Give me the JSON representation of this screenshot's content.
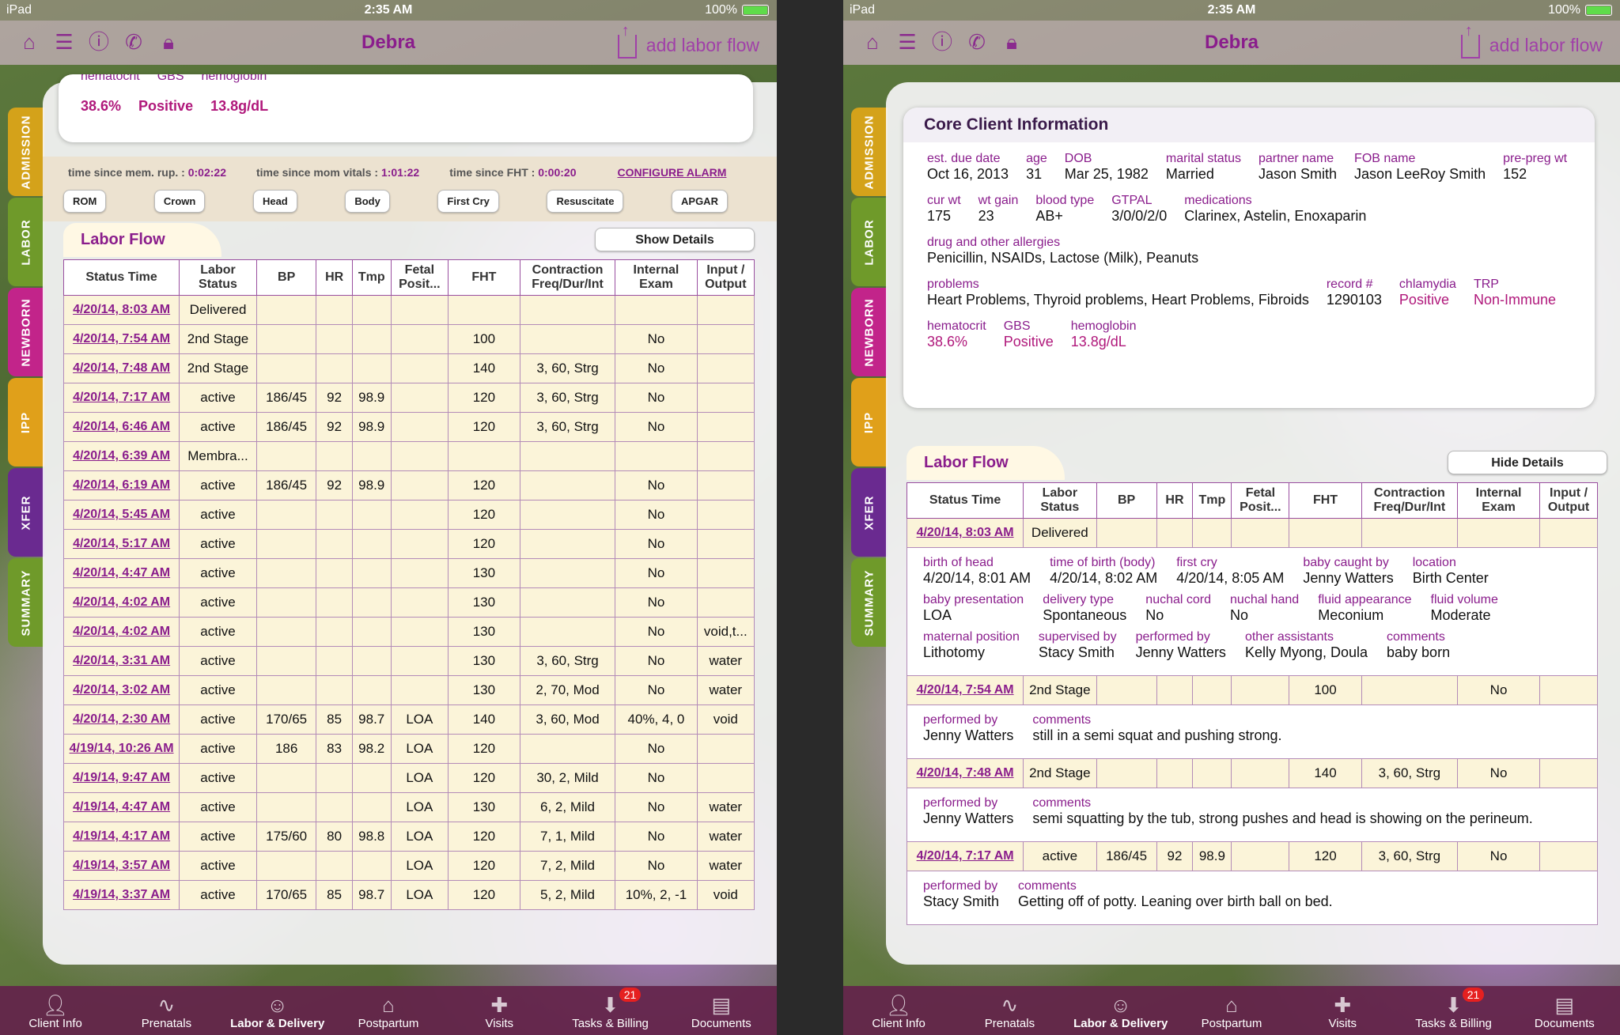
{
  "status_bar": {
    "device": "iPad",
    "time": "2:35 AM",
    "battery": "100%"
  },
  "nav": {
    "title": "Debra",
    "add_flow": "add labor flow"
  },
  "side_tabs": [
    {
      "label": "ADMISSION",
      "color": "#d4a21a"
    },
    {
      "label": "LABOR",
      "color": "#6f9a2a"
    },
    {
      "label": "NEWBORN",
      "color": "#c2248a"
    },
    {
      "label": "IPP",
      "color": "#e0a01a"
    },
    {
      "label": "XFER",
      "color": "#6a2a90"
    },
    {
      "label": "SUMMARY",
      "color": "#6f9a2a"
    }
  ],
  "left": {
    "top_card": {
      "partial_labels": [
        "hematocrit",
        "GBS",
        "hemoglobin"
      ],
      "values": [
        "38.6%",
        "Positive",
        "13.8g/dL"
      ]
    },
    "timers": [
      {
        "label": "time since mem. rup. :",
        "value": "0:02:22"
      },
      {
        "label": "time since mom vitals :",
        "value": "1:01:22"
      },
      {
        "label": "time since FHT :",
        "value": "0:00:20"
      }
    ],
    "configure_alarm": "CONFIGURE ALARM",
    "event_buttons": [
      "ROM",
      "Crown",
      "Head",
      "Body",
      "First Cry",
      "Resuscitate",
      "APGAR"
    ],
    "section_title": "Labor Flow",
    "details_button": "Show Details"
  },
  "table_headers": [
    "Status Time",
    "Labor Status",
    "BP",
    "HR",
    "Tmp",
    "Fetal Posit...",
    "FHT",
    "Contraction Freq/Dur/Int",
    "Internal Exam",
    "Input / Output"
  ],
  "rows": [
    [
      "4/20/14, 8:03 AM",
      "Delivered",
      "",
      "",
      "",
      "",
      "",
      "",
      "",
      ""
    ],
    [
      "4/20/14, 7:54 AM",
      "2nd Stage",
      "",
      "",
      "",
      "",
      "100",
      "",
      "No",
      ""
    ],
    [
      "4/20/14, 7:48 AM",
      "2nd Stage",
      "",
      "",
      "",
      "",
      "140",
      "3, 60, Strg",
      "No",
      ""
    ],
    [
      "4/20/14, 7:17 AM",
      "active",
      "186/45",
      "92",
      "98.9",
      "",
      "120",
      "3, 60, Strg",
      "No",
      ""
    ],
    [
      "4/20/14, 6:46 AM",
      "active",
      "186/45",
      "92",
      "98.9",
      "",
      "120",
      "3, 60, Strg",
      "No",
      ""
    ],
    [
      "4/20/14, 6:39 AM",
      "Membra...",
      "",
      "",
      "",
      "",
      "",
      "",
      "",
      ""
    ],
    [
      "4/20/14, 6:19 AM",
      "active",
      "186/45",
      "92",
      "98.9",
      "",
      "120",
      "",
      "No",
      ""
    ],
    [
      "4/20/14, 5:45 AM",
      "active",
      "",
      "",
      "",
      "",
      "120",
      "",
      "No",
      ""
    ],
    [
      "4/20/14, 5:17 AM",
      "active",
      "",
      "",
      "",
      "",
      "120",
      "",
      "No",
      ""
    ],
    [
      "4/20/14, 4:47 AM",
      "active",
      "",
      "",
      "",
      "",
      "130",
      "",
      "No",
      ""
    ],
    [
      "4/20/14, 4:02 AM",
      "active",
      "",
      "",
      "",
      "",
      "130",
      "",
      "No",
      ""
    ],
    [
      "4/20/14, 4:02 AM",
      "active",
      "",
      "",
      "",
      "",
      "130",
      "",
      "No",
      "void,t..."
    ],
    [
      "4/20/14, 3:31 AM",
      "active",
      "",
      "",
      "",
      "",
      "130",
      "3, 60, Strg",
      "No",
      "water"
    ],
    [
      "4/20/14, 3:02 AM",
      "active",
      "",
      "",
      "",
      "",
      "130",
      "2, 70, Mod",
      "No",
      "water"
    ],
    [
      "4/20/14, 2:30 AM",
      "active",
      "170/65",
      "85",
      "98.7",
      "LOA",
      "140",
      "3, 60, Mod",
      "40%, 4, 0",
      "void"
    ],
    [
      "4/19/14, 10:26 AM",
      "active",
      "186",
      "83",
      "98.2",
      "LOA",
      "120",
      "",
      "No",
      ""
    ],
    [
      "4/19/14, 9:47 AM",
      "active",
      "",
      "",
      "",
      "LOA",
      "120",
      "30, 2, Mild",
      "No",
      ""
    ],
    [
      "4/19/14, 4:47 AM",
      "active",
      "",
      "",
      "",
      "LOA",
      "130",
      "6, 2, Mild",
      "No",
      "water"
    ],
    [
      "4/19/14, 4:17 AM",
      "active",
      "175/60",
      "80",
      "98.8",
      "LOA",
      "120",
      "7, 1, Mild",
      "No",
      "water"
    ],
    [
      "4/19/14, 3:57 AM",
      "active",
      "",
      "",
      "",
      "LOA",
      "120",
      "7, 2, Mild",
      "No",
      "water"
    ],
    [
      "4/19/14, 3:37 AM",
      "active",
      "170/65",
      "85",
      "98.7",
      "LOA",
      "120",
      "5, 2, Mild",
      "10%, 2, -1",
      "void"
    ]
  ],
  "right": {
    "core_title": "Core Client Information",
    "core_rows": [
      [
        {
          "label": "est. due date",
          "value": "Oct 16, 2013"
        },
        {
          "label": "age",
          "value": "31"
        },
        {
          "label": "DOB",
          "value": "Mar 25, 1982"
        },
        {
          "label": "marital status",
          "value": "Married"
        },
        {
          "label": "partner name",
          "value": "Jason Smith"
        },
        {
          "label": "FOB name",
          "value": "Jason LeeRoy Smith"
        },
        {
          "label": "pre-preg wt",
          "value": "152"
        }
      ],
      [
        {
          "label": "cur wt",
          "value": "175"
        },
        {
          "label": "wt gain",
          "value": "23"
        },
        {
          "label": "blood type",
          "value": "AB+"
        },
        {
          "label": "GTPAL",
          "value": "3/0/0/2/0"
        },
        {
          "label": "medications",
          "value": "Clarinex, Astelin, Enoxaparin"
        }
      ],
      [
        {
          "label": "drug and other allergies",
          "value": "Penicillin, NSAIDs, Lactose (Milk), Peanuts"
        }
      ],
      [
        {
          "label": "problems",
          "value": "Heart Problems, Thyroid problems, Heart Problems, Fibroids"
        },
        {
          "label": "record #",
          "value": "1290103"
        },
        {
          "label": "chlamydia",
          "value": "Positive",
          "pink": true
        },
        {
          "label": "TRP",
          "value": "Non-Immune",
          "pink": true
        }
      ],
      [
        {
          "label": "hematocrit",
          "value": "38.6%",
          "pink": true
        },
        {
          "label": "GBS",
          "value": "Positive",
          "pink": true
        },
        {
          "label": "hemoglobin",
          "value": "13.8g/dL",
          "pink": true
        }
      ]
    ],
    "section_title": "Labor Flow",
    "details_button": "Hide Details",
    "flow": [
      {
        "row": [
          "4/20/14, 8:03 AM",
          "Delivered",
          "",
          "",
          "",
          "",
          "",
          "",
          "",
          ""
        ],
        "details": [
          [
            {
              "label": "birth of head",
              "value": "4/20/14, 8:01 AM"
            },
            {
              "label": "time of birth (body)",
              "value": "4/20/14, 8:02 AM"
            },
            {
              "label": "first cry",
              "value": "4/20/14, 8:05 AM"
            },
            {
              "label": "baby caught by",
              "value": "Jenny Watters"
            },
            {
              "label": "location",
              "value": "Birth Center"
            }
          ],
          [
            {
              "label": "baby presentation",
              "value": "LOA"
            },
            {
              "label": "delivery type",
              "value": "Spontaneous"
            },
            {
              "label": "nuchal cord",
              "value": "No"
            },
            {
              "label": "nuchal hand",
              "value": "No"
            },
            {
              "label": "fluid appearance",
              "value": "Meconium"
            },
            {
              "label": "fluid volume",
              "value": "Moderate"
            }
          ],
          [
            {
              "label": "maternal position",
              "value": "Lithotomy"
            },
            {
              "label": "supervised by",
              "value": "Stacy Smith"
            },
            {
              "label": "performed by",
              "value": "Jenny Watters"
            },
            {
              "label": "other assistants",
              "value": "Kelly Myong, Doula"
            },
            {
              "label": "comments",
              "value": "baby born"
            }
          ]
        ]
      },
      {
        "row": [
          "4/20/14, 7:54 AM",
          "2nd Stage",
          "",
          "",
          "",
          "",
          "100",
          "",
          "No",
          ""
        ],
        "details": [
          [
            {
              "label": "performed by",
              "value": "Jenny Watters"
            },
            {
              "label": "comments",
              "value": "still in a semi squat and pushing strong."
            }
          ]
        ]
      },
      {
        "row": [
          "4/20/14, 7:48 AM",
          "2nd Stage",
          "",
          "",
          "",
          "",
          "140",
          "3, 60, Strg",
          "No",
          ""
        ],
        "details": [
          [
            {
              "label": "performed by",
              "value": "Jenny Watters"
            },
            {
              "label": "comments",
              "value": "semi squatting by the tub, strong pushes and head is showing on the perineum."
            }
          ]
        ]
      },
      {
        "row": [
          "4/20/14, 7:17 AM",
          "active",
          "186/45",
          "92",
          "98.9",
          "",
          "120",
          "3, 60, Strg",
          "No",
          ""
        ],
        "details": [
          [
            {
              "label": "performed by",
              "value": "Stacy Smith"
            },
            {
              "label": "comments",
              "value": "Getting off of potty.   Leaning over birth ball on bed."
            }
          ]
        ]
      }
    ]
  },
  "tab_bar": [
    {
      "label": "Client Info",
      "icon": "person-icon"
    },
    {
      "label": "Prenatals",
      "icon": "heartbeat-icon"
    },
    {
      "label": "Labor & Delivery",
      "icon": "baby-icon",
      "active": true
    },
    {
      "label": "Postpartum",
      "icon": "house-icon"
    },
    {
      "label": "Visits",
      "icon": "medical-bag-icon"
    },
    {
      "label": "Tasks & Billing",
      "icon": "inbox-icon",
      "badge": "21"
    },
    {
      "label": "Documents",
      "icon": "cabinet-icon"
    }
  ]
}
